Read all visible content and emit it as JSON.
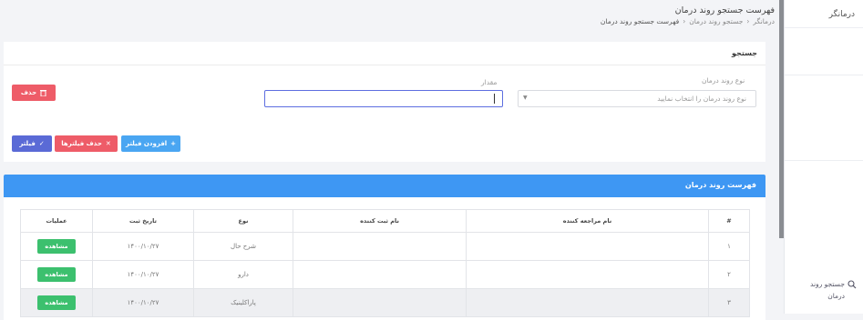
{
  "header": {
    "title": "فهرست جستجو روند درمان",
    "breadcrumb": [
      "درمانگر",
      "جستجو روند درمان",
      "فهرست جستجو روند درمان"
    ]
  },
  "sidebar": {
    "brand": "درمانگر",
    "items": [
      {
        "label": "جستجو روند درمان",
        "icon": "search-icon"
      }
    ]
  },
  "search": {
    "title": "جستجو",
    "type_label": "نوع روند درمان",
    "type_placeholder": "نوع روند درمان را انتخاب نمایید",
    "value_label": "مقدار",
    "value": "",
    "delete_label": "حذف",
    "add_filter_label": "افزودن فیلتر",
    "clear_filters_label": "حذف فیلترها",
    "filter_label": "فیلتر"
  },
  "list": {
    "title": "فهرست روند درمان",
    "columns": [
      "#",
      "نام مراجعه کننده",
      "نام ثبت کننده",
      "نوع",
      "تاریخ ثبت",
      "عملیات"
    ],
    "rows": [
      {
        "num": "۱",
        "client": "",
        "registrar": "",
        "type": "شرح حال",
        "date": "۱۴۰۰/۱۰/۲۷",
        "action": "مشاهده"
      },
      {
        "num": "۲",
        "client": "",
        "registrar": "",
        "type": "دارو",
        "date": "۱۴۰۰/۱۰/۲۷",
        "action": "مشاهده"
      },
      {
        "num": "۳",
        "client": "",
        "registrar": "",
        "type": "پاراکلینیک",
        "date": "۱۴۰۰/۱۰/۲۷",
        "action": "مشاهده"
      }
    ]
  },
  "colors": {
    "primary": "#3e97f3",
    "danger": "#ee5c68",
    "success": "#3cc06e",
    "indigo": "#5a6ad6"
  }
}
